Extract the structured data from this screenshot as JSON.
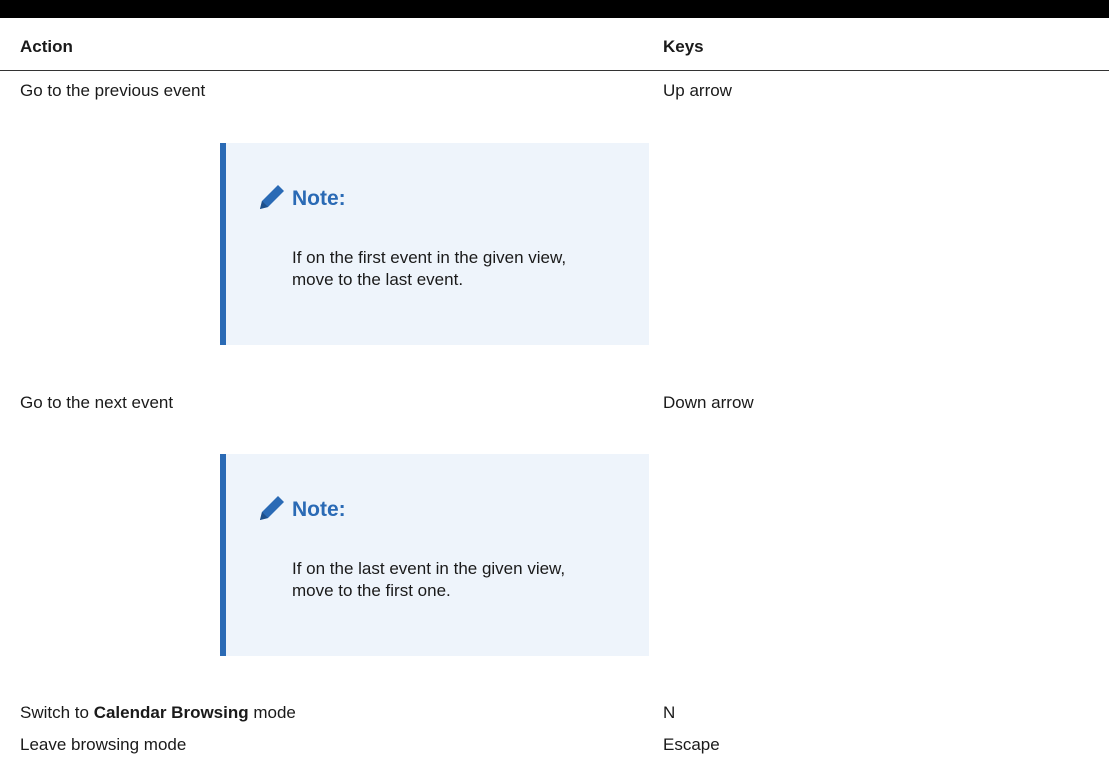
{
  "table": {
    "headers": {
      "action": "Action",
      "keys": "Keys"
    },
    "rows": [
      {
        "action": "Go to the previous event",
        "keys": "Up arrow",
        "note": {
          "icon": "pencil-icon",
          "title": "Note:",
          "body": "If on the first event in the given view, move to the last event."
        }
      },
      {
        "action": "Go to the next event",
        "keys": "Down arrow",
        "note": {
          "icon": "pencil-icon",
          "title": "Note:",
          "body": "If on the last event in the given view, move to the first one."
        }
      },
      {
        "action_prefix": "Switch to ",
        "action_bold": "Calendar Browsing",
        "action_suffix": " mode",
        "keys": "N"
      },
      {
        "action": "Leave browsing mode",
        "keys": "Escape"
      }
    ]
  },
  "colors": {
    "note_accent": "#2a6ab5",
    "note_background": "#eef4fb",
    "top_rule": "#000000"
  }
}
